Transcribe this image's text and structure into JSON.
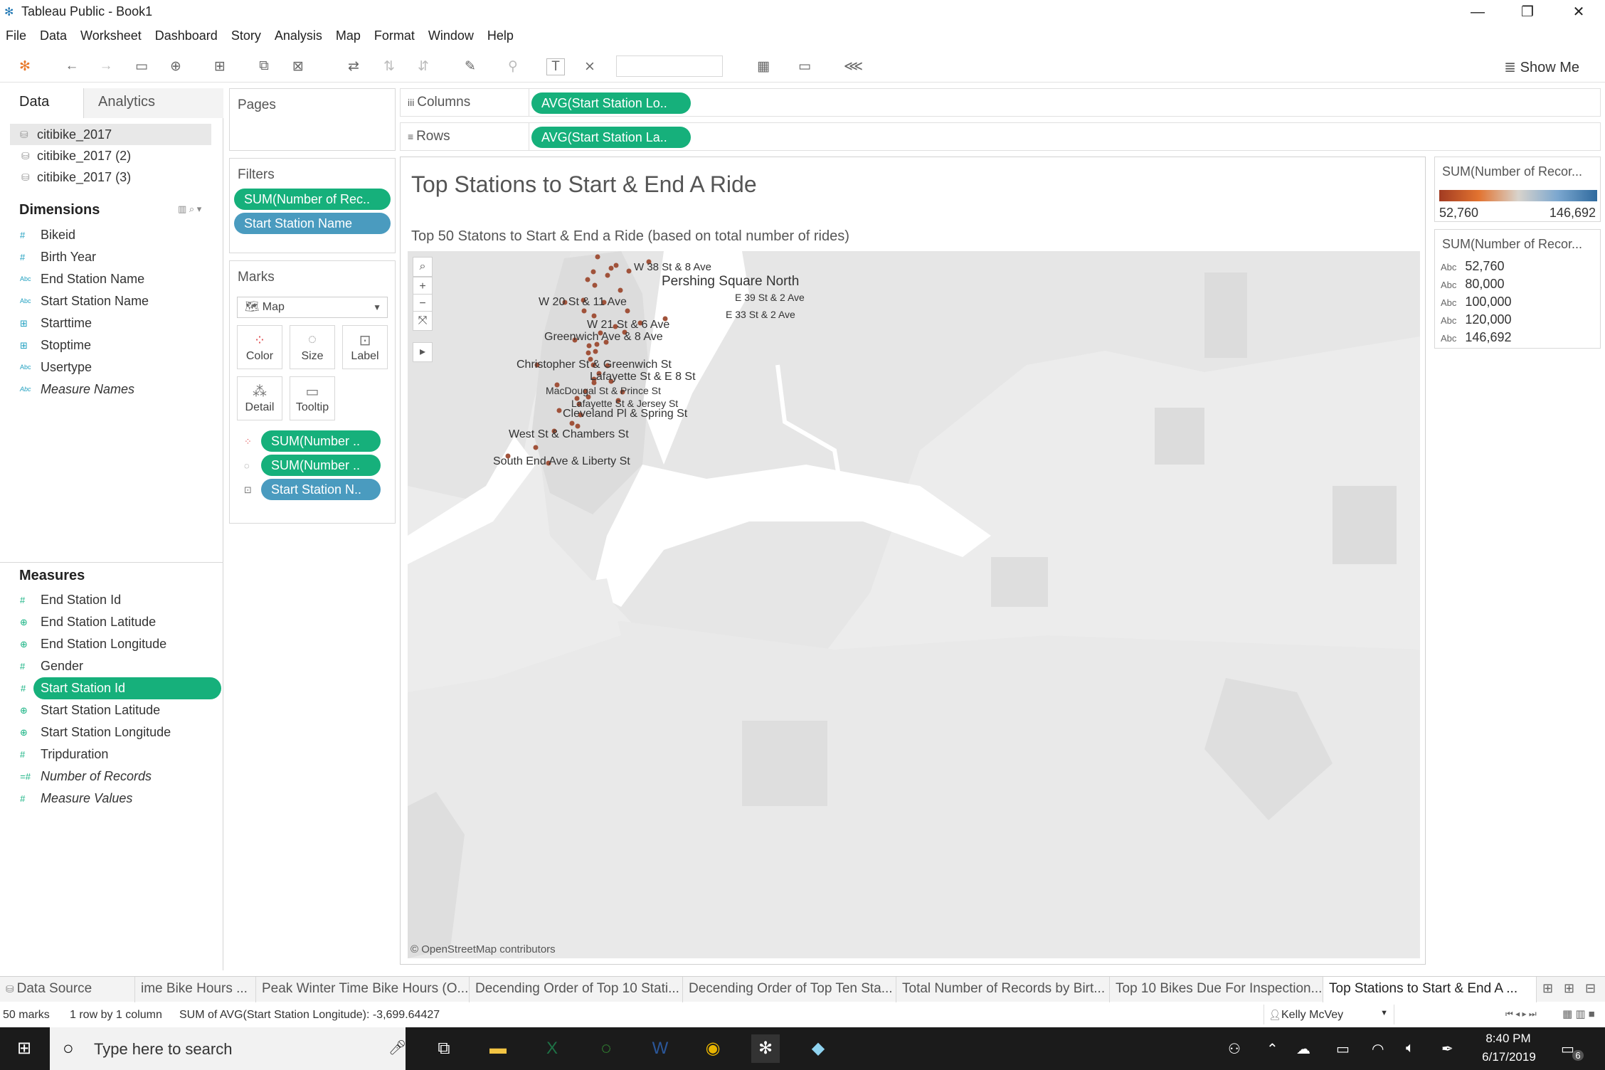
{
  "window": {
    "title": "Tableau Public - Book1"
  },
  "menu": [
    "File",
    "Data",
    "Worksheet",
    "Dashboard",
    "Story",
    "Analysis",
    "Map",
    "Format",
    "Window",
    "Help"
  ],
  "toolbar": {
    "show_me": "Show Me"
  },
  "data_pane": {
    "tab_data": "Data",
    "tab_analytics": "Analytics",
    "sources": [
      "citibike_2017",
      "citibike_2017 (2)",
      "citibike_2017 (3)"
    ],
    "dimensions_header": "Dimensions",
    "dimensions": [
      "Bikeid",
      "Birth Year",
      "End Station Name",
      "Start Station Name",
      "Starttime",
      "Stoptime",
      "Usertype",
      "Measure Names"
    ],
    "measures_header": "Measures",
    "measures": [
      "End Station Id",
      "End Station Latitude",
      "End Station Longitude",
      "Gender",
      "Start Station Id",
      "Start Station Latitude",
      "Start Station Longitude",
      "Tripduration",
      "Number of Records",
      "Measure Values"
    ]
  },
  "cards": {
    "pages": "Pages",
    "filters": "Filters",
    "filter_pills": [
      "SUM(Number of Rec..",
      "Start Station Name"
    ],
    "marks": "Marks",
    "mark_type": "Map",
    "mark_buttons": [
      "Color",
      "Size",
      "Label",
      "Detail",
      "Tooltip"
    ],
    "mark_pills": [
      "SUM(Number ..",
      "SUM(Number ..",
      "Start Station N.."
    ]
  },
  "shelves": {
    "columns_label": "Columns",
    "columns_pill": "AVG(Start Station Lo..",
    "rows_label": "Rows",
    "rows_pill": "AVG(Start Station La.."
  },
  "view": {
    "title": "Top Stations to Start & End A Ride",
    "subtitle": "Top 50 Statons to Start & End a Ride (based on total number of rides)",
    "attribution": "© OpenStreetMap contributors",
    "labels": [
      "W 38 St & 8 Ave",
      "Pershing Square North",
      "E 39 St & 2 Ave",
      "W 20 St & 11 Ave",
      "E 33 St & 2 Ave",
      "W 21 St & 6 Ave",
      "Greenwich Ave & 8 Ave",
      "Christopher St & Greenwich St",
      "Lafayette St & E 8 St",
      "MacDougal St & Prince St",
      "Lafayette St & Jersey St",
      "Cleveland Pl & Spring St",
      "West St & Chambers St",
      "South End Ave & Liberty St"
    ]
  },
  "legends": {
    "color_title": "SUM(Number of Recor...",
    "color_min": "52,760",
    "color_max": "146,692",
    "size_title": "SUM(Number of Recor...",
    "size_values": [
      "52,760",
      "80,000",
      "100,000",
      "120,000",
      "146,692"
    ],
    "abc": "Abc"
  },
  "sheet_tabs": [
    "Data Source",
    "ime Bike Hours ...",
    "Peak Winter Time Bike Hours (O...",
    "Decending Order of Top 10 Stati...",
    "Decending Order of Top Ten Sta...",
    "Total Number of Records by Birt...",
    "Top 10 Bikes Due For Inspection...",
    "Top Stations to Start & End A ..."
  ],
  "status": {
    "marks": "50 marks",
    "rows_cols": "1 row by 1 column",
    "sum": "SUM of AVG(Start Station Longitude): -3,699.64427",
    "user": "Kelly McVey"
  },
  "taskbar": {
    "search": "Type here to search",
    "time": "8:40 PM",
    "date": "6/17/2019",
    "notif": "6"
  }
}
